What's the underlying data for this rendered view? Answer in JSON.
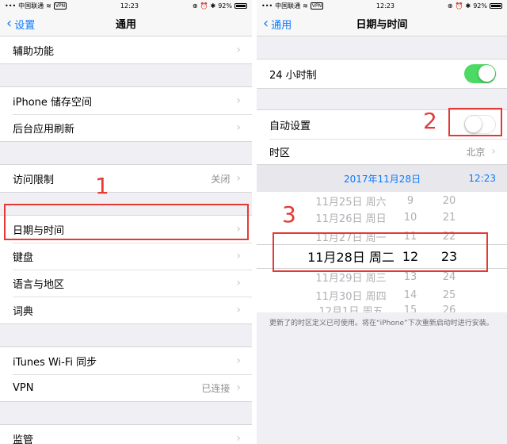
{
  "status": {
    "carrier": "中国联通",
    "vpn": "VPN",
    "time": "12:23",
    "battery": "92%"
  },
  "left": {
    "back_label": "设置",
    "title": "通用",
    "group1": [
      {
        "label": "辅助功能"
      }
    ],
    "group2": [
      {
        "label": "iPhone 储存空间"
      },
      {
        "label": "后台应用刷新"
      }
    ],
    "group3": [
      {
        "label": "访问限制",
        "value": "关闭"
      }
    ],
    "group4": [
      {
        "label": "日期与时间"
      },
      {
        "label": "键盘"
      },
      {
        "label": "语言与地区"
      },
      {
        "label": "词典"
      }
    ],
    "group5": [
      {
        "label": "iTunes Wi-Fi 同步"
      },
      {
        "label": "VPN",
        "value": "已连接"
      }
    ],
    "group6": [
      {
        "label": "监管"
      }
    ]
  },
  "right": {
    "back_label": "通用",
    "title": "日期与时间",
    "hour24_label": "24 小时制",
    "auto_set_label": "自动设置",
    "timezone_label": "时区",
    "timezone_value": "北京",
    "selected_date": "2017年11月28日",
    "selected_time": "12:23",
    "picker_rows": [
      {
        "date": "11月25日 周六",
        "hour": "9",
        "min": "20"
      },
      {
        "date": "11月26日 周日",
        "hour": "10",
        "min": "21"
      },
      {
        "date": "11月27日 周一",
        "hour": "11",
        "min": "22"
      },
      {
        "date": "11月28日 周二",
        "hour": "12",
        "min": "23"
      },
      {
        "date": "11月29日 周三",
        "hour": "13",
        "min": "24"
      },
      {
        "date": "11月30日 周四",
        "hour": "14",
        "min": "25"
      },
      {
        "date": "12月1日 周五",
        "hour": "15",
        "min": "26"
      }
    ],
    "footnote": "更新了的时区定义已可使用。将在“iPhone”下次重新启动时进行安装。",
    "hour24_on": true,
    "auto_set_on": false
  },
  "annotations": {
    "one": "1",
    "two": "2",
    "three": "3"
  },
  "colors": {
    "accent": "#0a7aff",
    "toggle_on": "#4cd964",
    "annotation": "#e53935"
  }
}
